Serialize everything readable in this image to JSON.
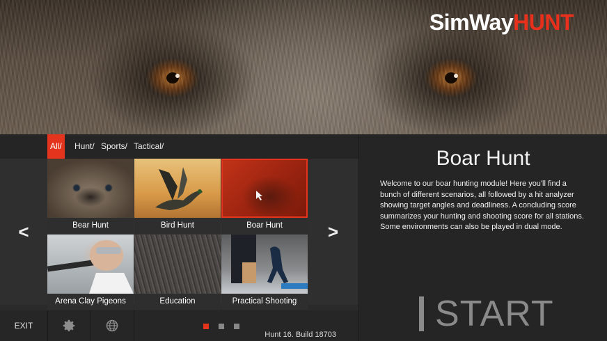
{
  "brand": {
    "sim": "SimWay",
    "hunt": "HUNT",
    "accent": "#e5341d"
  },
  "filters": [
    {
      "label": "All/",
      "active": true
    },
    {
      "label": "Hunt/",
      "active": false
    },
    {
      "label": "Sports/",
      "active": false
    },
    {
      "label": "Tactical/",
      "active": false
    }
  ],
  "nav": {
    "prev": "<",
    "next": ">"
  },
  "tiles": [
    {
      "label": "Bear Hunt"
    },
    {
      "label": "Bird Hunt"
    },
    {
      "label": "Boar Hunt",
      "selected": true
    },
    {
      "label": "Arena Clay Pigeons"
    },
    {
      "label": "Education"
    },
    {
      "label": "Practical Shooting"
    }
  ],
  "bottom": {
    "exit": "EXIT",
    "settings_icon": "gear-icon",
    "globe_icon": "globe-icon",
    "build": "Hunt 16. Build 18703",
    "page_dots": 3,
    "active_page": 1
  },
  "detail": {
    "title": "Boar Hunt",
    "description": "Welcome to our boar hunting module! Here you'll find a bunch of different scenarios, all followed by a hit analyzer showing target angles and deadliness. A concluding score summarizes your hunting and shooting score for all stations. Some environments can also be played in dual mode.",
    "start": "START"
  }
}
